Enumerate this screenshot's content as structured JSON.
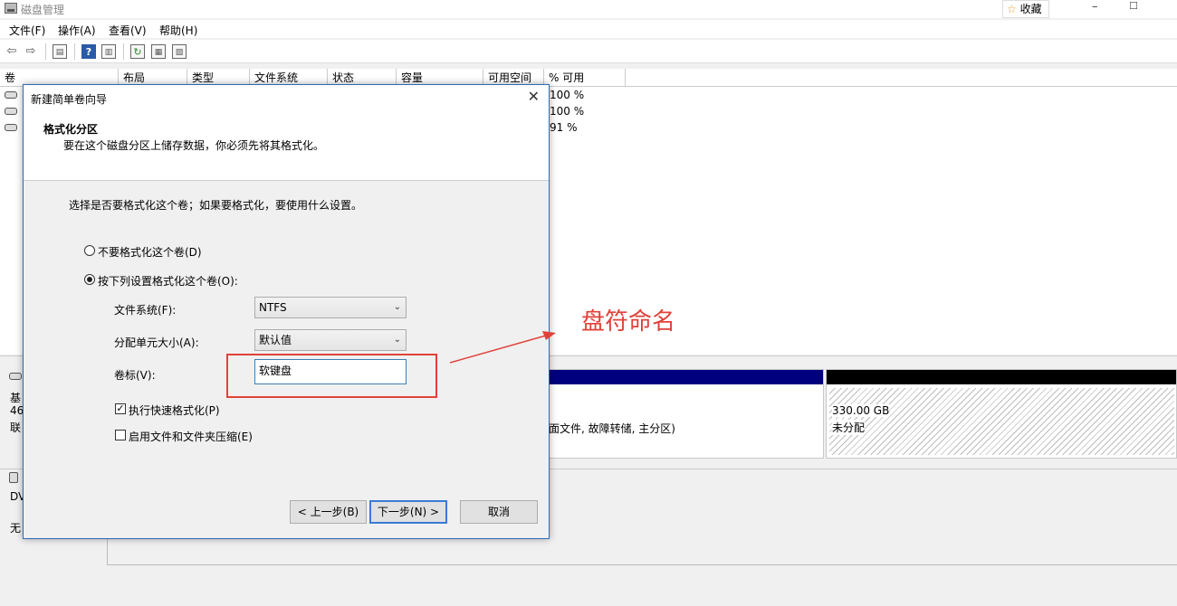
{
  "window": {
    "title": "磁盘管理",
    "favorite_label": "收藏",
    "minimize": "–",
    "restore": "☐"
  },
  "menu": [
    "文件(F)",
    "操作(A)",
    "查看(V)",
    "帮助(H)"
  ],
  "volume_table": {
    "columns": [
      "卷",
      "布局",
      "类型",
      "文件系统",
      "状态",
      "容量",
      "可用空间",
      "% 可用"
    ],
    "rows": [
      {
        "percent_free": "100 %"
      },
      {
        "percent_free": "100 %"
      },
      {
        "percent_free": "91 %"
      }
    ]
  },
  "disk_pane": {
    "disk0": {
      "label1": "基",
      "label2": "46",
      "label3": "联"
    },
    "partition_desc": "面文件, 故障转储, 主分区)",
    "unallocated": {
      "size": "330.00 GB",
      "status": "未分配"
    },
    "disk1": {
      "label1": "DV",
      "label2": "无"
    }
  },
  "dialog": {
    "title": "新建简单卷向导",
    "heading": "格式化分区",
    "subheading": "要在这个磁盘分区上储存数据，你必须先将其格式化。",
    "prompt": "选择是否要格式化这个卷；如果要格式化，要使用什么设置。",
    "radio_no_format": "不要格式化这个卷(D)",
    "radio_format": "按下列设置格式化这个卷(O):",
    "radio_selected": "format",
    "fs_label": "文件系统(F):",
    "fs_value": "NTFS",
    "alloc_label": "分配单元大小(A):",
    "alloc_value": "默认值",
    "volume_label_label": "卷标(V):",
    "volume_label_value": "软键盘",
    "quick_format_label": "执行快速格式化(P)",
    "quick_format_checked": true,
    "compression_label": "启用文件和文件夹压缩(E)",
    "compression_checked": false,
    "back_button": "< 上一步(B)",
    "next_button": "下一步(N) >",
    "cancel_button": "取消"
  },
  "annotation": {
    "text": "盘符命名",
    "color": "#e0423a"
  },
  "colors": {
    "primary_partition_bar": "#00007f",
    "disk_bar": "#000000",
    "accent": "#2b6bb8"
  }
}
